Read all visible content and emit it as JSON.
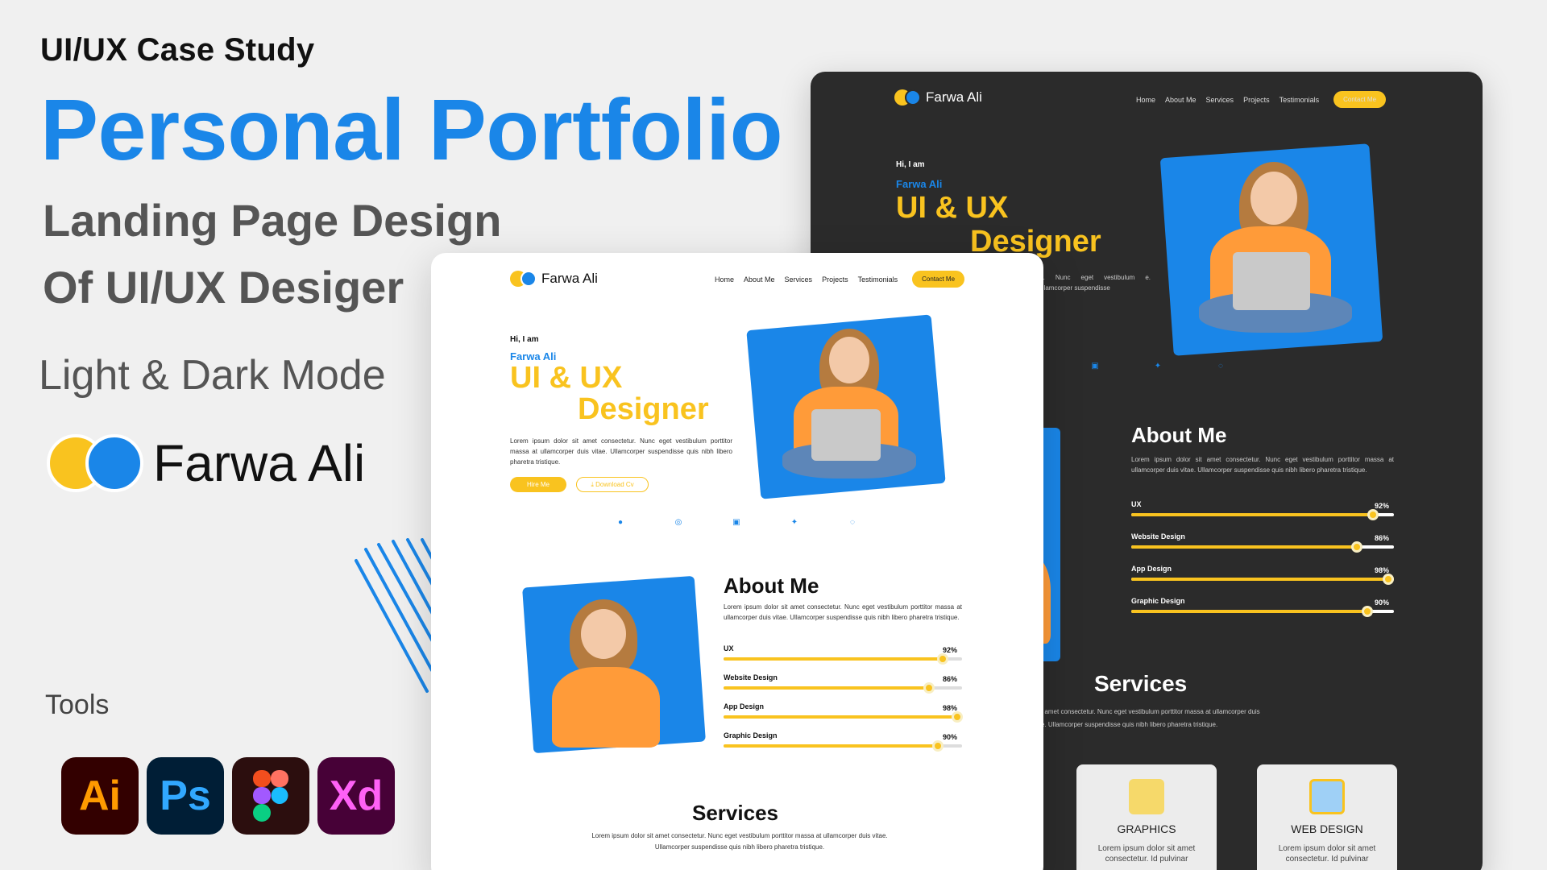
{
  "intro": {
    "case_study": "UI/UX Case Study",
    "headline": "Personal Portfolio",
    "sub1": "Landing Page Design",
    "sub2": "Of UI/UX Desiger",
    "mode": "Light & Dark Mode",
    "brand_name": "Farwa Ali",
    "tools_label": "Tools",
    "tools": [
      "Ai",
      "Ps",
      "figma-icon",
      "Xd"
    ]
  },
  "site": {
    "logo_name": "Farwa Ali",
    "nav": [
      "Home",
      "About Me",
      "Services",
      "Projects",
      "Testimonials"
    ],
    "contact_btn": "Contact Me",
    "hi": "Hi, I am",
    "name": "Farwa Ali",
    "role_line1": "UI & UX",
    "role_line2": "Designer",
    "hero_para": "Lorem ipsum dolor sit amet consectetur. Nunc eget vestibulum porttitor massa at ullamcorper duis vitae. Ullamcorper suspendisse quis nibh libero pharetra tristique.",
    "dark_hero_para": "ur. Nunc eget vestibulum e. Ullamcorper suspendisse",
    "hire_btn": "Hire Me",
    "download_btn": "Download Cv",
    "socials": [
      "facebook-icon",
      "instagram-icon",
      "linkedin-icon",
      "twitter-icon",
      "whatsapp-icon"
    ],
    "about_title": "About Me",
    "about_para": "Lorem ipsum dolor sit amet consectetur. Nunc eget vestibulum porttitor massa at ullamcorper duis vitae. Ullamcorper suspendisse quis nibh libero pharetra tristique.",
    "skills": [
      {
        "label": "UX",
        "pct": "92%",
        "value": 92
      },
      {
        "label": "Website Design",
        "pct": "86%",
        "value": 86
      },
      {
        "label": "App Design",
        "pct": "98%",
        "value": 98
      },
      {
        "label": "Graphic Design",
        "pct": "90%",
        "value": 90
      }
    ],
    "services_title": "Services",
    "services_para": "Lorem ipsum dolor sit amet consectetur. Nunc eget vestibulum porttitor massa at ullamcorper duis vitae. Ullamcorper suspendisse quis nibh libero pharetra tristique.",
    "dark_services_para1": "t amet consectetur. Nunc eget vestibulum porttitor massa at ullamcorper duis",
    "dark_services_para2": "e. Ullamcorper suspendisse quis nibh libero pharetra tristique.",
    "cards": [
      {
        "title": "GRAPHICS",
        "desc": "Lorem ipsum dolor sit amet consectetur. Id pulvinar"
      },
      {
        "title": "WEB DESIGN",
        "desc": "Lorem ipsum dolor sit amet consectetur. Id pulvinar"
      }
    ]
  },
  "colors": {
    "accent_blue": "#1a86e8",
    "accent_yellow": "#f9c31f",
    "dark_bg": "#2b2b2b"
  }
}
